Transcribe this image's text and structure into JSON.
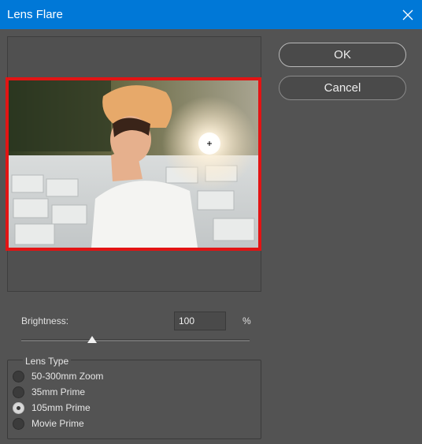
{
  "window": {
    "title": "Lens Flare"
  },
  "buttons": {
    "ok": "OK",
    "cancel": "Cancel"
  },
  "brightness": {
    "label": "Brightness:",
    "value": "100",
    "unit": "%",
    "slider_fraction": 0.31
  },
  "lens_type": {
    "legend": "Lens Type",
    "options": [
      "50-300mm Zoom",
      "35mm Prime",
      "105mm Prime",
      "Movie Prime"
    ],
    "selected": "105mm Prime"
  },
  "colors": {
    "titlebar": "#0078d7",
    "preview_border": "#e21414",
    "dialog_bg": "#535353"
  },
  "icons": {
    "close": "close-icon",
    "flare_center": "crosshair-icon"
  }
}
